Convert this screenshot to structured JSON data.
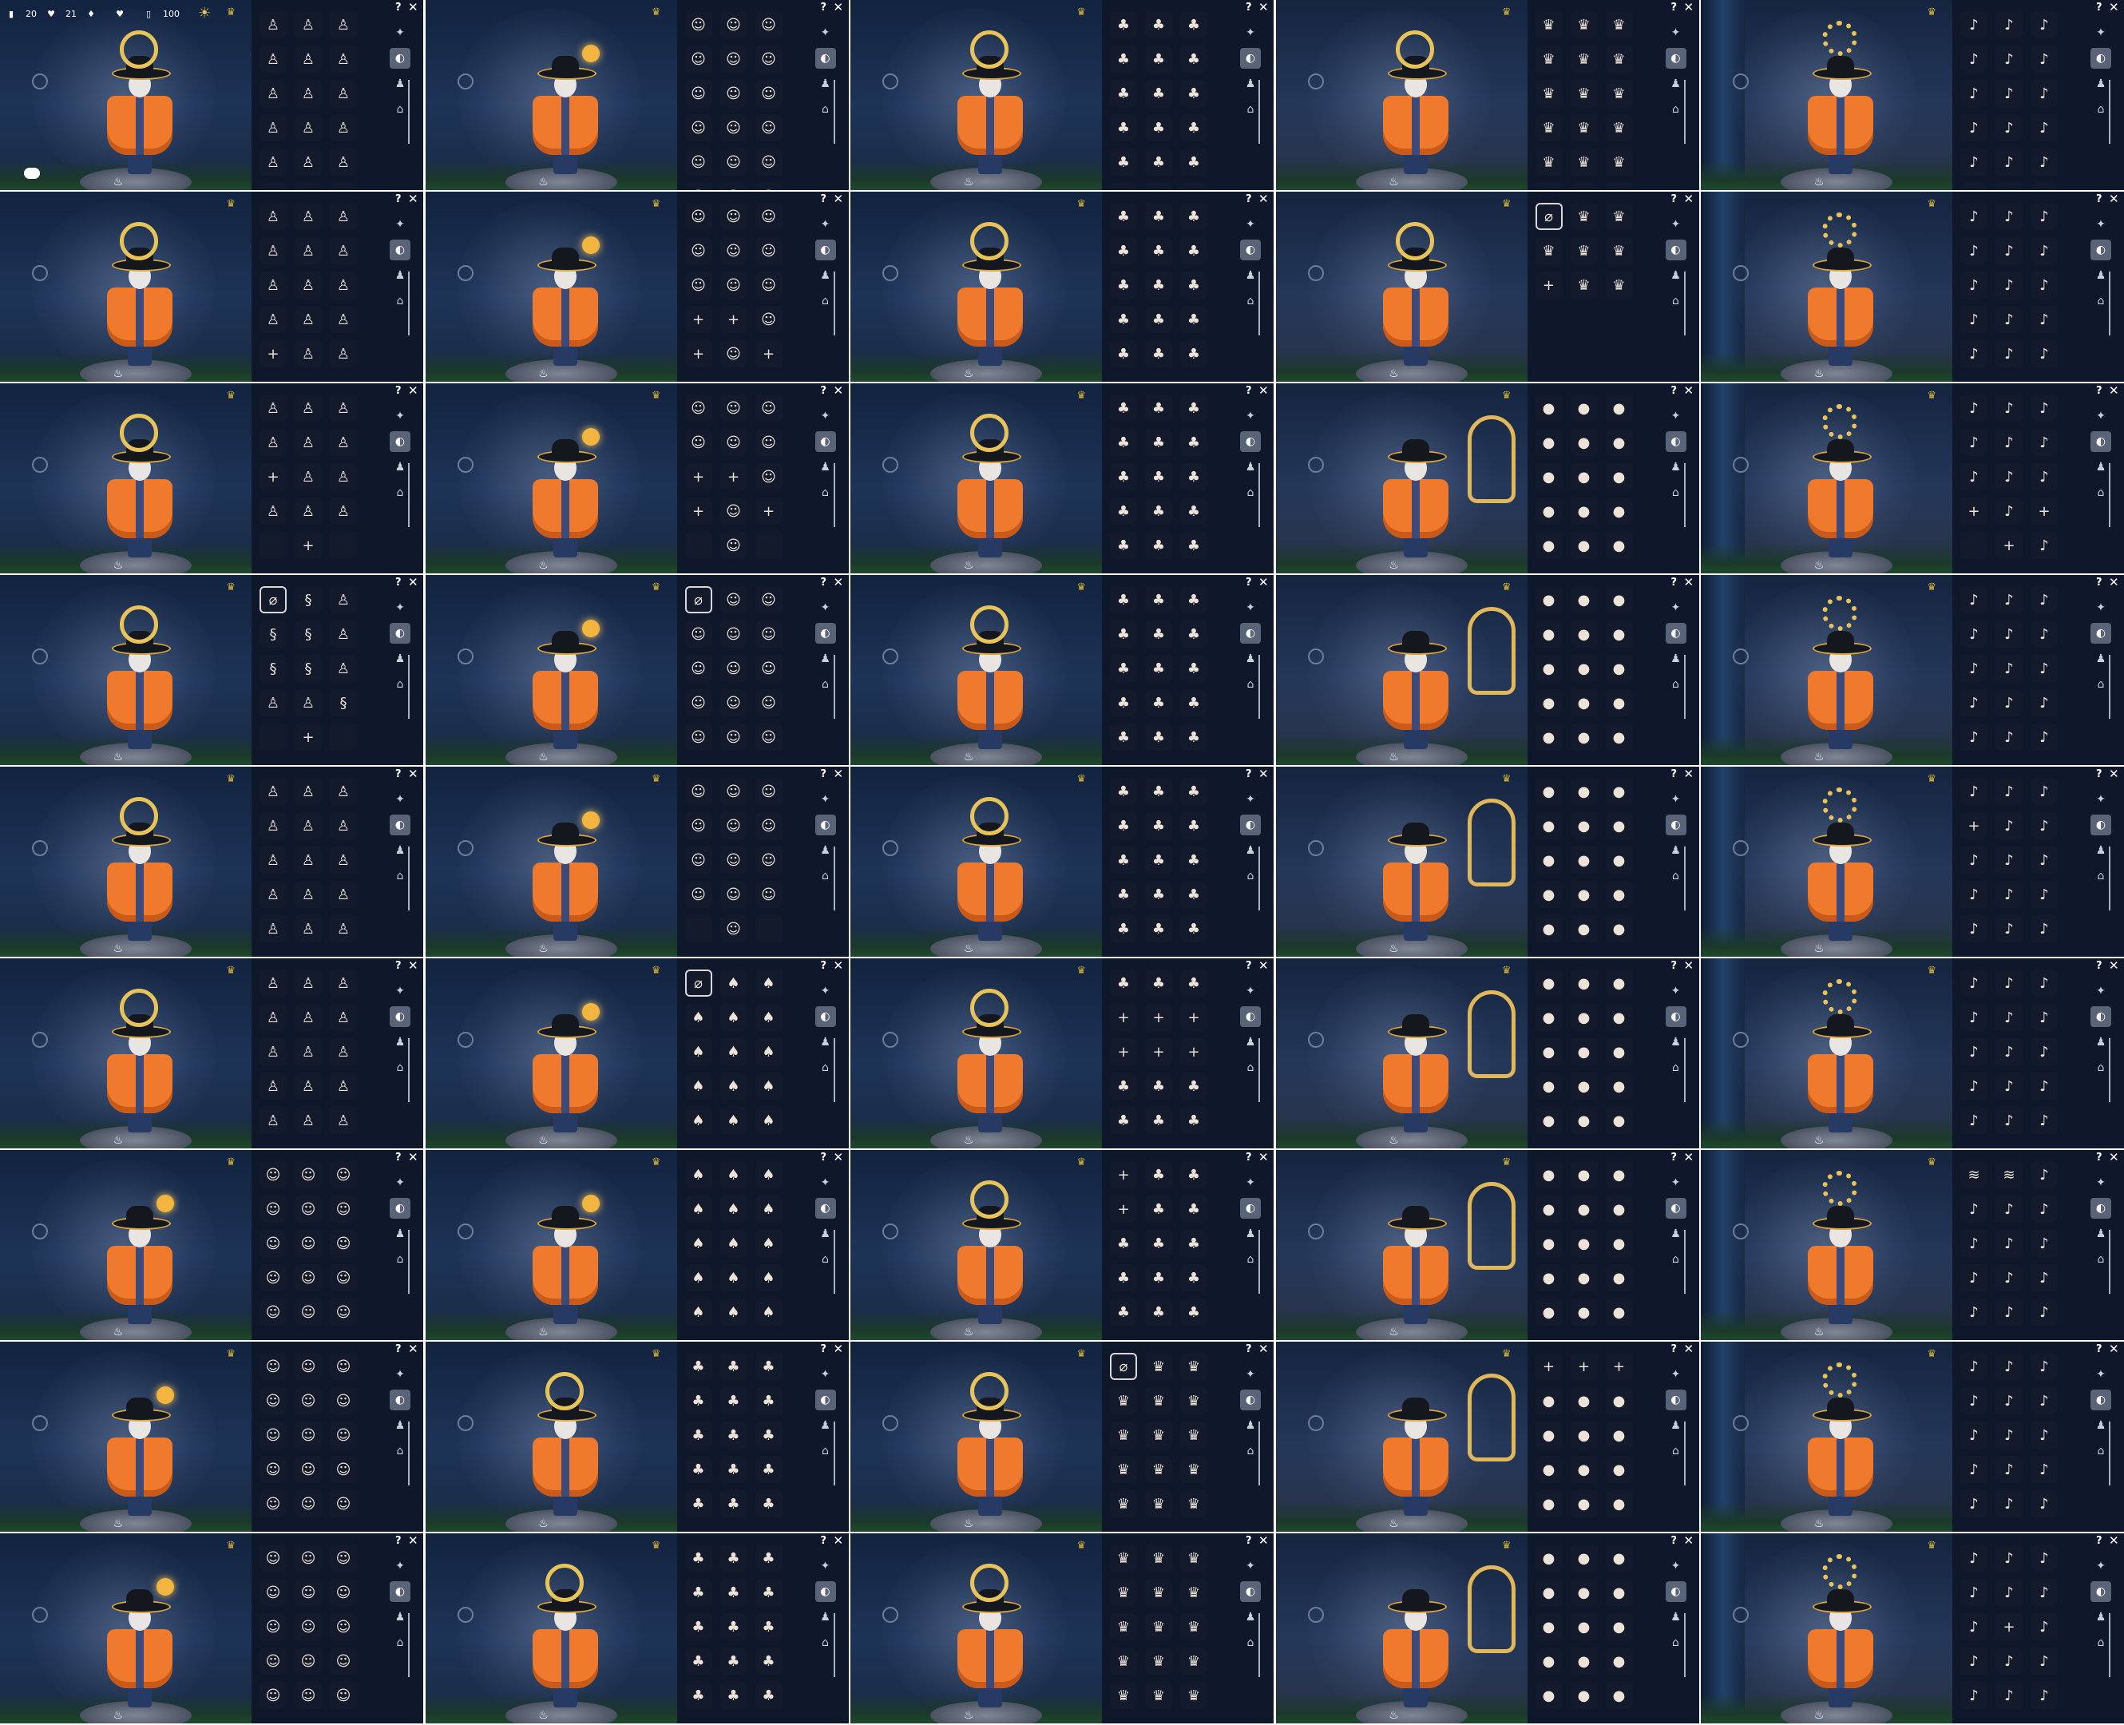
{
  "hud": {
    "candles": "20",
    "hearts": "21",
    "ascended": "",
    "hearts_gold": "",
    "season": "100",
    "items_icon": "hud-icons"
  },
  "panel_controls": {
    "help": "?",
    "close": "✕"
  },
  "colors": {
    "bg": "#1a2d4c",
    "cape": "#ef7a2e",
    "gold": "#e8c357",
    "panel": "#0e1628"
  },
  "tiles": [
    {
      "scene": "hat-mask",
      "halo": "none",
      "glyphs": [
        "♙",
        "♙",
        "♙",
        "♙",
        "♙",
        "♙",
        "♙",
        "♙",
        "♙",
        "♙",
        "♙",
        "♙",
        "♙",
        "♙",
        "♙",
        "♙",
        "♙",
        "♙"
      ],
      "hud": true
    },
    {
      "scene": "orb",
      "glyphs": [
        "☺",
        "☺",
        "☺",
        "☺",
        "☺",
        "☺",
        "☺",
        "☺",
        "☺",
        "☺",
        "☺",
        "☺",
        "☺",
        "☺",
        "☺",
        "☺",
        "☺",
        "☺"
      ]
    },
    {
      "scene": "halo",
      "glyphs": [
        "♣",
        "♣",
        "♣",
        "♣",
        "♣",
        "♣",
        "♣",
        "♣",
        "♣",
        "♣",
        "♣",
        "♣",
        "♣",
        "♣",
        "♣",
        "♣",
        "♣",
        "♣"
      ]
    },
    {
      "scene": "halo",
      "glyphs": [
        "♛",
        "♛",
        "♛",
        "♛",
        "♛",
        "♛",
        "♛",
        "♛",
        "♛",
        "♛",
        "♛",
        "♛",
        "♛",
        "♛",
        "♛",
        "♛",
        "♛",
        "♛"
      ]
    },
    {
      "scene": "sun",
      "glyphs": [
        "♪",
        "♪",
        "♪",
        "♪",
        "♪",
        "♪",
        "♪",
        "♪",
        "♪",
        "♪",
        "♪",
        "♪",
        "♪",
        "♪",
        "♪",
        "♪",
        "♪",
        "♪"
      ]
    },
    {
      "scene": "hat-mask",
      "glyphs": [
        "♙",
        "♙",
        "♙",
        "♙",
        "♙",
        "♙",
        "♙",
        "♙",
        "♙",
        "♙",
        "♙",
        "♙",
        "+",
        "♙",
        "♙"
      ]
    },
    {
      "scene": "orb",
      "glyphs": [
        "☺",
        "☺",
        "☺",
        "☺",
        "☺",
        "☺",
        "☺",
        "☺",
        "☺",
        "+",
        "+",
        "☺",
        "+",
        "☺",
        "+"
      ]
    },
    {
      "scene": "halo",
      "glyphs": [
        "♣",
        "♣",
        "♣",
        "♣",
        "♣",
        "♣",
        "♣",
        "♣",
        "♣",
        "♣",
        "♣",
        "♣",
        "♣",
        "♣",
        "♣"
      ]
    },
    {
      "scene": "halo",
      "glyphs": [
        "⌀",
        "♛",
        "♛",
        "♛",
        "♛",
        "♛",
        "+",
        "♛",
        "♛"
      ]
    },
    {
      "scene": "sun",
      "glyphs": [
        "♪",
        "♪",
        "♪",
        "♪",
        "♪",
        "♪",
        "♪",
        "♪",
        "♪",
        "♪",
        "♪",
        "♪",
        "♪",
        "♪",
        "♪"
      ]
    },
    {
      "scene": "hat-mask",
      "glyphs": [
        "♙",
        "♙",
        "♙",
        "♙",
        "♙",
        "♙",
        "+",
        "♙",
        "♙",
        "♙",
        "♙",
        "♙",
        "",
        "+",
        ""
      ]
    },
    {
      "scene": "orb",
      "glyphs": [
        "☺",
        "☺",
        "☺",
        "☺",
        "☺",
        "☺",
        "+",
        "+",
        "☺",
        "+",
        "☺",
        "+",
        "",
        "☺",
        ""
      ]
    },
    {
      "scene": "halo",
      "glyphs": [
        "♣",
        "♣",
        "♣",
        "♣",
        "♣",
        "♣",
        "♣",
        "♣",
        "♣",
        "♣",
        "♣",
        "♣",
        "♣",
        "♣",
        "♣"
      ]
    },
    {
      "scene": "ghost",
      "glyphs": [
        "●",
        "●",
        "●",
        "●",
        "●",
        "●",
        "●",
        "●",
        "●",
        "●",
        "●",
        "●",
        "●",
        "●",
        "●"
      ]
    },
    {
      "scene": "sun",
      "glyphs": [
        "♪",
        "♪",
        "♪",
        "♪",
        "♪",
        "♪",
        "♪",
        "♪",
        "♪",
        "+",
        "♪",
        "+",
        "",
        "+",
        "♪"
      ]
    },
    {
      "scene": "hat-mask",
      "glyphs": [
        "⌀",
        "§",
        "♙",
        "§",
        "§",
        "♙",
        "§",
        "§",
        "♙",
        "♙",
        "♙",
        "§",
        "",
        "+",
        ""
      ]
    },
    {
      "scene": "orb",
      "glyphs": [
        "⌀",
        "☺",
        "☺",
        "☺",
        "☺",
        "☺",
        "☺",
        "☺",
        "☺",
        "☺",
        "☺",
        "☺",
        "☺",
        "☺",
        "☺"
      ]
    },
    {
      "scene": "halo",
      "glyphs": [
        "♣",
        "♣",
        "♣",
        "♣",
        "♣",
        "♣",
        "♣",
        "♣",
        "♣",
        "♣",
        "♣",
        "♣",
        "♣",
        "♣",
        "♣"
      ]
    },
    {
      "scene": "ghost",
      "glyphs": [
        "●",
        "●",
        "●",
        "●",
        "●",
        "●",
        "●",
        "●",
        "●",
        "●",
        "●",
        "●",
        "●",
        "●",
        "●"
      ]
    },
    {
      "scene": "sun",
      "glyphs": [
        "♪",
        "♪",
        "♪",
        "♪",
        "♪",
        "♪",
        "♪",
        "♪",
        "♪",
        "♪",
        "♪",
        "♪",
        "♪",
        "♪",
        "♪"
      ]
    },
    {
      "scene": "hat-mask",
      "glyphs": [
        "♙",
        "♙",
        "♙",
        "♙",
        "♙",
        "♙",
        "♙",
        "♙",
        "♙",
        "♙",
        "♙",
        "♙",
        "♙",
        "♙",
        "♙"
      ]
    },
    {
      "scene": "orb",
      "glyphs": [
        "☺",
        "☺",
        "☺",
        "☺",
        "☺",
        "☺",
        "☺",
        "☺",
        "☺",
        "☺",
        "☺",
        "☺",
        "",
        "☺",
        ""
      ]
    },
    {
      "scene": "halo",
      "glyphs": [
        "♣",
        "♣",
        "♣",
        "♣",
        "♣",
        "♣",
        "♣",
        "♣",
        "♣",
        "♣",
        "♣",
        "♣",
        "♣",
        "♣",
        "♣"
      ]
    },
    {
      "scene": "ghost",
      "glyphs": [
        "●",
        "●",
        "●",
        "●",
        "●",
        "●",
        "●",
        "●",
        "●",
        "●",
        "●",
        "●",
        "●",
        "●",
        "●"
      ]
    },
    {
      "scene": "sun",
      "glyphs": [
        "♪",
        "♪",
        "♪",
        "+",
        "♪",
        "♪",
        "♪",
        "♪",
        "♪",
        "♪",
        "♪",
        "♪",
        "♪",
        "♪",
        "♪"
      ]
    },
    {
      "scene": "hat-mask",
      "glyphs": [
        "♙",
        "♙",
        "♙",
        "♙",
        "♙",
        "♙",
        "♙",
        "♙",
        "♙",
        "♙",
        "♙",
        "♙",
        "♙",
        "♙",
        "♙"
      ]
    },
    {
      "scene": "orb",
      "glyphs": [
        "⌀",
        "♠",
        "♠",
        "♠",
        "♠",
        "♠",
        "♠",
        "♠",
        "♠",
        "♠",
        "♠",
        "♠",
        "♠",
        "♠",
        "♠"
      ]
    },
    {
      "scene": "halo",
      "glyphs": [
        "♣",
        "♣",
        "♣",
        "+",
        "+",
        "+",
        "+",
        "+",
        "+",
        "♣",
        "♣",
        "♣",
        "♣",
        "♣",
        "♣"
      ]
    },
    {
      "scene": "ghost",
      "glyphs": [
        "●",
        "●",
        "●",
        "●",
        "●",
        "●",
        "●",
        "●",
        "●",
        "●",
        "●",
        "●",
        "●",
        "●",
        "●"
      ]
    },
    {
      "scene": "sun",
      "glyphs": [
        "♪",
        "♪",
        "♪",
        "♪",
        "♪",
        "♪",
        "♪",
        "♪",
        "♪",
        "♪",
        "♪",
        "♪",
        "♪",
        "♪",
        "♪"
      ]
    },
    {
      "scene": "orb-small",
      "glyphs": [
        "☺",
        "☺",
        "☺",
        "☺",
        "☺",
        "☺",
        "☺",
        "☺",
        "☺",
        "☺",
        "☺",
        "☺",
        "☺",
        "☺",
        "☺"
      ]
    },
    {
      "scene": "orb",
      "glyphs": [
        "♠",
        "♠",
        "♠",
        "♠",
        "♠",
        "♠",
        "♠",
        "♠",
        "♠",
        "♠",
        "♠",
        "♠",
        "♠",
        "♠",
        "♠"
      ]
    },
    {
      "scene": "halo",
      "glyphs": [
        "+",
        "♣",
        "♣",
        "+",
        "♣",
        "♣",
        "♣",
        "♣",
        "♣",
        "♣",
        "♣",
        "♣",
        "♣",
        "♣",
        "♣"
      ]
    },
    {
      "scene": "ghost",
      "glyphs": [
        "●",
        "●",
        "●",
        "●",
        "●",
        "●",
        "●",
        "●",
        "●",
        "●",
        "●",
        "●",
        "●",
        "●",
        "●"
      ]
    },
    {
      "scene": "sun",
      "glyphs": [
        "≋",
        "≋",
        "♪",
        "♪",
        "♪",
        "♪",
        "♪",
        "♪",
        "♪",
        "♪",
        "♪",
        "♪",
        "♪",
        "♪",
        "♪"
      ]
    },
    {
      "scene": "orb-small",
      "glyphs": [
        "☺",
        "☺",
        "☺",
        "☺",
        "☺",
        "☺",
        "☺",
        "☺",
        "☺",
        "☺",
        "☺",
        "☺",
        "☺",
        "☺",
        "☺"
      ]
    },
    {
      "scene": "halo-side",
      "glyphs": [
        "♣",
        "♣",
        "♣",
        "♣",
        "♣",
        "♣",
        "♣",
        "♣",
        "♣",
        "♣",
        "♣",
        "♣",
        "♣",
        "♣",
        "♣"
      ]
    },
    {
      "scene": "halo",
      "glyphs": [
        "⌀",
        "♛",
        "♛",
        "♛",
        "♛",
        "♛",
        "♛",
        "♛",
        "♛",
        "♛",
        "♛",
        "♛",
        "♛",
        "♛",
        "♛"
      ]
    },
    {
      "scene": "ghost",
      "glyphs": [
        "+",
        "+",
        "+",
        "●",
        "●",
        "●",
        "●",
        "●",
        "●",
        "●",
        "●",
        "●",
        "●",
        "●",
        "●"
      ]
    },
    {
      "scene": "sun",
      "glyphs": [
        "♪",
        "♪",
        "♪",
        "♪",
        "♪",
        "♪",
        "♪",
        "♪",
        "♪",
        "♪",
        "♪",
        "♪",
        "♪",
        "♪",
        "♪"
      ]
    },
    {
      "scene": "orb-small",
      "glyphs": [
        "☺",
        "☺",
        "☺",
        "☺",
        "☺",
        "☺",
        "☺",
        "☺",
        "☺",
        "☺",
        "☺",
        "☺",
        "☺",
        "☺",
        "☺"
      ]
    },
    {
      "scene": "halo-side",
      "glyphs": [
        "♣",
        "♣",
        "♣",
        "♣",
        "♣",
        "♣",
        "♣",
        "♣",
        "♣",
        "♣",
        "♣",
        "♣",
        "♣",
        "♣",
        "♣"
      ]
    },
    {
      "scene": "halo",
      "glyphs": [
        "♛",
        "♛",
        "♛",
        "♛",
        "♛",
        "♛",
        "♛",
        "♛",
        "♛",
        "♛",
        "♛",
        "♛",
        "♛",
        "♛",
        "♛"
      ]
    },
    {
      "scene": "ghost",
      "glyphs": [
        "●",
        "●",
        "●",
        "●",
        "●",
        "●",
        "●",
        "●",
        "●",
        "●",
        "●",
        "●",
        "●",
        "●",
        "●"
      ]
    },
    {
      "scene": "sun",
      "glyphs": [
        "♪",
        "♪",
        "♪",
        "♪",
        "♪",
        "♪",
        "♪",
        "+",
        "♪",
        "♪",
        "♪",
        "♪",
        "♪",
        "♪",
        "♪"
      ]
    }
  ]
}
